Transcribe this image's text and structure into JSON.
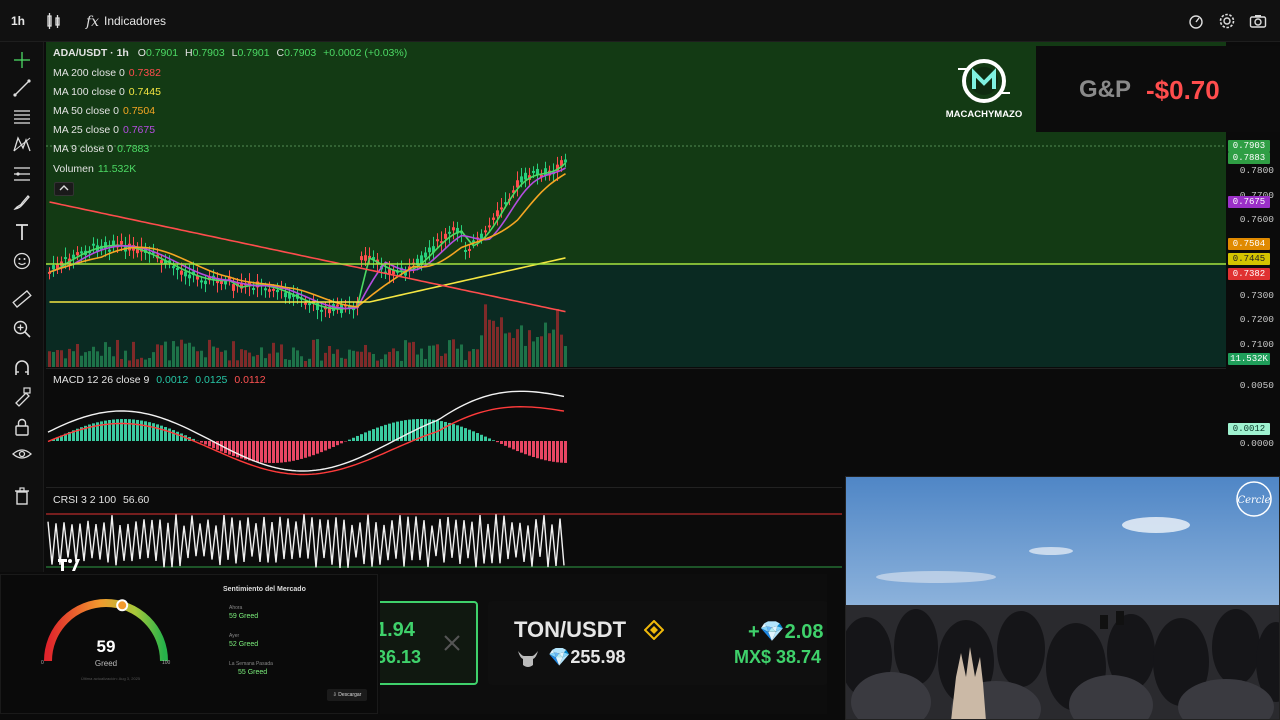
{
  "toolbar": {
    "interval": "1h",
    "indicators_label": "Indicadores"
  },
  "legend": {
    "symbol": "ADA/USDT · 1h",
    "o_lbl": "O",
    "o": "0.7901",
    "h_lbl": "H",
    "h": "0.7903",
    "l_lbl": "L",
    "l": "0.7901",
    "c_lbl": "C",
    "c": "0.7903",
    "change": "+0.0002 (+0.03%)",
    "ma200": {
      "label": "MA 200 close 0",
      "value": "0.7382",
      "color": "#ff4d4d"
    },
    "ma100": {
      "label": "MA 100 close 0",
      "value": "0.7445",
      "color": "#f5e642"
    },
    "ma50": {
      "label": "MA 50 close 0",
      "value": "0.7504",
      "color": "#f5a623"
    },
    "ma25": {
      "label": "MA 25 close 0",
      "value": "0.7675",
      "color": "#b44de0"
    },
    "ma9": {
      "label": "MA 9 close 0",
      "value": "0.7883",
      "color": "#4cd964"
    },
    "volume": {
      "label": "Volumen",
      "value": "11.532K"
    }
  },
  "price_axis": {
    "ticks": [
      "0.7800",
      "0.7700",
      "0.7600",
      "0.7300",
      "0.7200",
      "0.7100"
    ],
    "tags": [
      {
        "text": "0.7903",
        "color": "#2f9e44"
      },
      {
        "text": "0.7883",
        "color": "#2f9e44"
      },
      {
        "text": "0.7675",
        "color": "#9b30c8"
      },
      {
        "text": "0.7504",
        "color": "#e08a00"
      },
      {
        "text": "0.7445",
        "color": "#d4c400"
      },
      {
        "text": "0.7382",
        "color": "#e03131"
      },
      {
        "text": "11.532K",
        "color": "#1f9e5a"
      }
    ]
  },
  "macd": {
    "label": "MACD 12 26 close 9",
    "v1": "0.0012",
    "v2": "0.0125",
    "v3": "0.0112",
    "ticks": [
      "0.0050",
      "0.0000"
    ],
    "tag": "0.0012"
  },
  "rsi": {
    "label": "CRSI 3 2 100",
    "value": "56.60"
  },
  "brand": {
    "name": "MACACHYMAZO"
  },
  "gp": {
    "label": "G&P",
    "value": "-$0.70"
  },
  "sentiment": {
    "title": "Sentimiento del Mercado",
    "rows": [
      {
        "label": "Ahora",
        "value": "59 Greed"
      },
      {
        "label": "Ayer",
        "value": "52 Greed"
      },
      {
        "label": "La Semana Pasada",
        "value": "55 Greed"
      }
    ],
    "gauge_value": 59,
    "gauge_text": "59",
    "gauge_label": "Greed",
    "scale_min": "0",
    "scale_max": "100",
    "updated": "Última actualización: Aug 3, 2025",
    "download": "Descargar"
  },
  "ticker": {
    "card1_pct": "1.94",
    "card1_sub": "36.13",
    "pair": "TON/USDT",
    "pct": "+💎2.08",
    "price": "💎255.98",
    "mxn": "MX$ 38.74"
  },
  "watermark": "Cercle"
}
